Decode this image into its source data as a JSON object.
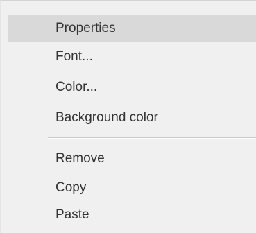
{
  "context_menu": {
    "group1": [
      {
        "label": "Properties",
        "highlighted": true
      },
      {
        "label": "Font..."
      },
      {
        "label": "Color..."
      },
      {
        "label": "Background color"
      }
    ],
    "group2": [
      {
        "label": "Remove"
      },
      {
        "label": "Copy"
      },
      {
        "label": "Paste"
      }
    ]
  }
}
